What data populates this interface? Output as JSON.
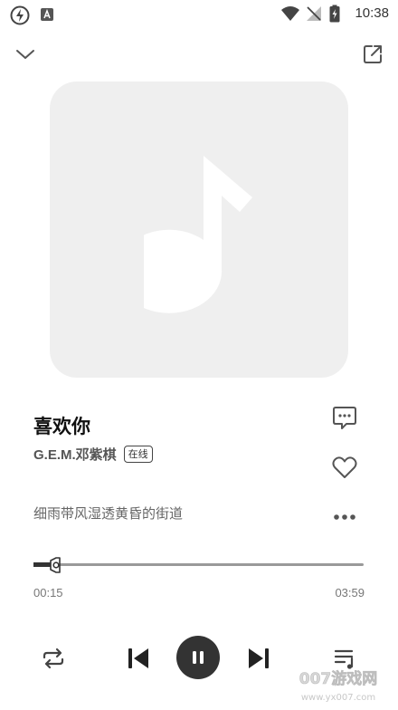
{
  "status_bar": {
    "time": "10:38",
    "left_icons": [
      "flash-icon",
      "a-notification-icon"
    ],
    "right_icons": [
      "wifi-icon",
      "no-signal-icon",
      "battery-charging-icon"
    ]
  },
  "header": {
    "collapse_icon": "chevron-down-icon",
    "share_icon": "share-external-icon"
  },
  "album_art": {
    "placeholder_icon": "music-note-icon",
    "bg_color": "#efefef",
    "note_color": "#ffffff"
  },
  "song": {
    "title": "喜欢你",
    "artist": "G.E.M.邓紫棋",
    "source_badge": "在线",
    "current_lyric": "细雨带风湿透黄昏的街道"
  },
  "side_actions": [
    "comment-icon",
    "heart-icon",
    "more-icon"
  ],
  "progress": {
    "current_time": "00:15",
    "total_time": "03:59",
    "fraction": 0.063
  },
  "controls": [
    "repeat-icon",
    "previous-icon",
    "pause-icon",
    "next-icon",
    "playlist-icon"
  ],
  "watermark": {
    "text": "007游戏网",
    "url": "www.yx007.com"
  }
}
